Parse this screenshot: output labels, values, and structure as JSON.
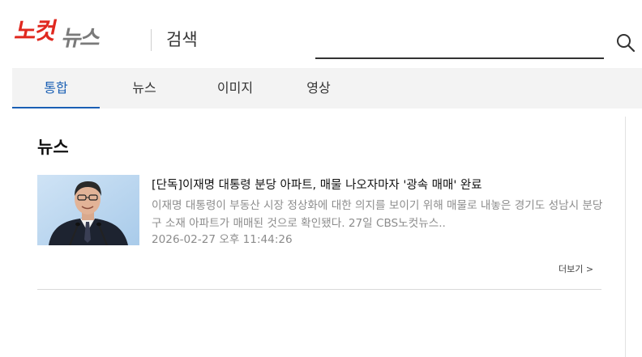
{
  "header": {
    "logo_text": "노컷뉴스",
    "title": "검색",
    "search": {
      "value": "",
      "placeholder": ""
    }
  },
  "tabs": [
    {
      "label": "통합",
      "active": true
    },
    {
      "label": "뉴스",
      "active": false
    },
    {
      "label": "이미지",
      "active": false
    },
    {
      "label": "영상",
      "active": false
    }
  ],
  "news": {
    "section_title": "뉴스",
    "article": {
      "title": "[단독]이재명 대통령 분당 아파트, 매물 나오자마자 '광속 매매' 완료",
      "summary": "이재명 대통령이 부동산 시장 정상화에 대한 의지를 보이기 위해 매물로 내놓은 경기도 성남시 분당구 소재 아파트가 매매된 것으로 확인됐다. 27일 CBS노컷뉴스..",
      "datetime": "2026-02-27 오후 11:44:26",
      "thumbnail": "photo of a man in a dark suit speaking at microphones in front of a light blue backdrop"
    },
    "more_label": "더보기 >"
  },
  "colors": {
    "brand_red": "#e0281f",
    "brand_gray": "#7a7a7a",
    "accent_blue": "#1a5fb4",
    "tab_background": "#f3f3f3",
    "muted_text": "#8c8c8c"
  },
  "icons": {
    "search": "search-icon",
    "logo": "nocut-news-logo"
  }
}
